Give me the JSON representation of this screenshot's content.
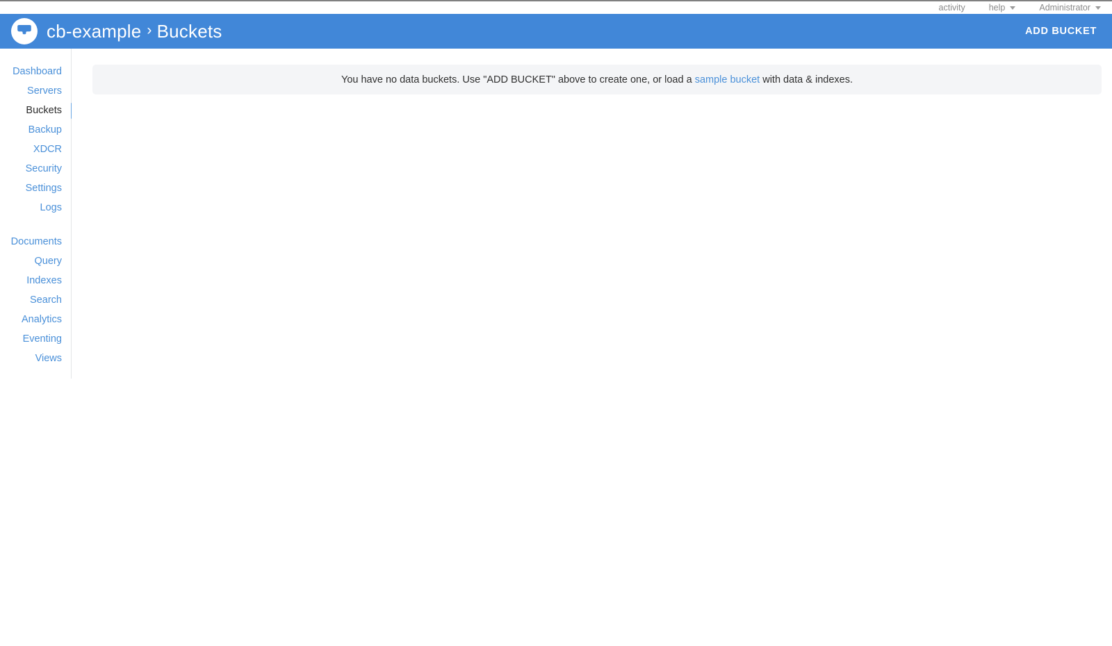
{
  "topbar": {
    "items": [
      {
        "label": "activity",
        "has_caret": false,
        "icon": ""
      },
      {
        "label": "help",
        "has_caret": true,
        "icon": "chevron-down-icon"
      },
      {
        "label": "Administrator",
        "has_caret": true,
        "icon": "chevron-down-icon"
      }
    ]
  },
  "header": {
    "logo_icon": "couchbase-logo-icon",
    "breadcrumb": {
      "cluster": "cb-example",
      "separator": "›",
      "current": "Buckets"
    },
    "add_bucket_label": "ADD BUCKET",
    "background_color": "#4187d8"
  },
  "sidebar": {
    "active_item": "Buckets",
    "groups": [
      {
        "items": [
          {
            "label": "Dashboard"
          },
          {
            "label": "Servers"
          },
          {
            "label": "Buckets"
          },
          {
            "label": "Backup"
          },
          {
            "label": "XDCR"
          },
          {
            "label": "Security"
          },
          {
            "label": "Settings"
          },
          {
            "label": "Logs"
          }
        ]
      },
      {
        "items": [
          {
            "label": "Documents"
          },
          {
            "label": "Query"
          },
          {
            "label": "Indexes"
          },
          {
            "label": "Search"
          },
          {
            "label": "Analytics"
          },
          {
            "label": "Eventing"
          },
          {
            "label": "Views"
          }
        ]
      }
    ],
    "link_color": "#4a90d9",
    "active_color": "#2b2b2b",
    "active_indicator_color": "#6ba7e3"
  },
  "main": {
    "empty_state": {
      "text_before": "You have no data buckets. Use \"ADD BUCKET\" above to create one, or load a ",
      "link_text": "sample bucket",
      "text_after": " with data & indexes.",
      "panel_background": "#f4f5f7"
    }
  }
}
